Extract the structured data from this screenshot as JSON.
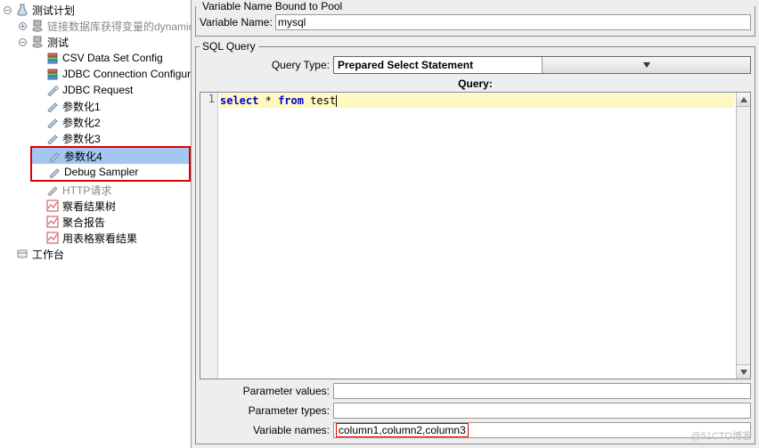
{
  "tree": {
    "root": "测试计划",
    "dynamic": "链接数据库获得变量的dynamic",
    "test": "测试",
    "csv": "CSV Data Set Config",
    "jdbc_conn": "JDBC Connection Configurati",
    "jdbc_req": "JDBC Request",
    "p1": "参数化1",
    "p2": "参数化2",
    "p3": "参数化3",
    "p4": "参数化4",
    "debug": "Debug Sampler",
    "http": "HTTP请求",
    "view_tree": "察看结果树",
    "agg": "聚合报告",
    "table_res": "用表格察看结果",
    "workbench": "工作台"
  },
  "pool": {
    "legend": "Variable Name Bound to Pool",
    "varname_label": "Variable Name:",
    "varname_value": "mysql"
  },
  "sql": {
    "legend": "SQL Query",
    "query_type_label": "Query Type:",
    "query_type_value": "Prepared Select Statement",
    "query_label": "Query:",
    "line_no": "1",
    "kw_select": "select",
    "op_star": "*",
    "kw_from": "from",
    "tbl": "test"
  },
  "params": {
    "values_label": "Parameter values:",
    "types_label": "Parameter types:",
    "varnames_label": "Variable names:",
    "varnames_value": "column1,column2,column3"
  },
  "watermark": "@51CTO博客"
}
